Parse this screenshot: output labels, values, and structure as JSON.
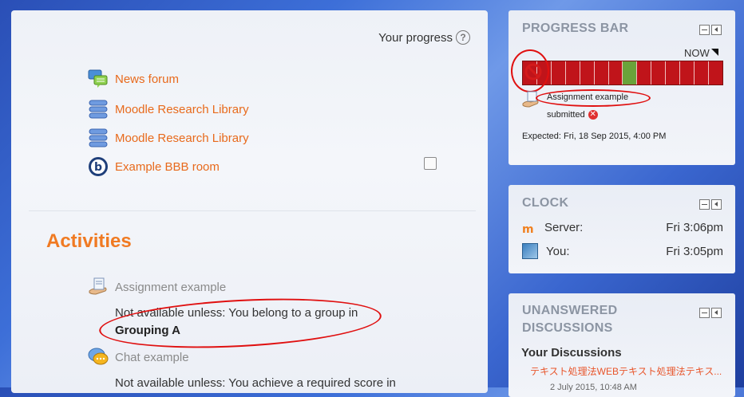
{
  "main": {
    "your_progress": "Your progress",
    "help": "?",
    "resources": [
      {
        "label": "News forum",
        "icon": "forum-icon"
      },
      {
        "label": "Moodle Research Library",
        "icon": "database-icon"
      },
      {
        "label": "Moodle Research Library",
        "icon": "database-icon"
      },
      {
        "label": "Example BBB room",
        "icon": "bigbluebutton-icon"
      }
    ],
    "activities_heading": "Activities",
    "activities": [
      {
        "label": "Assignment example",
        "icon": "assignment-icon",
        "restriction_line1": "Not available unless: You belong to a group in",
        "restriction_line2": "Grouping A"
      },
      {
        "label": "Chat example",
        "icon": "chat-icon",
        "restriction_line1": "Not available unless: You achieve a required score in"
      }
    ]
  },
  "progress_block": {
    "title": "PROGRESS BAR",
    "now_label": "NOW",
    "cells": [
      "red",
      "red",
      "red",
      "red",
      "red",
      "red",
      "red",
      "green",
      "red",
      "red",
      "red",
      "red",
      "red",
      "red"
    ],
    "item_label": "Assignment example",
    "status": "submitted",
    "expected": "Expected: Fri, 18 Sep 2015, 4:00 PM",
    "colors": {
      "red": "#c0141a",
      "green": "#6aa33a"
    }
  },
  "clock_block": {
    "title": "CLOCK",
    "server_label": "Server:",
    "server_time": "Fri 3:06pm",
    "you_label": "You:",
    "you_time": "Fri 3:05pm"
  },
  "unanswered_block": {
    "title_line1": "UNANSWERED",
    "title_line2": "DISCUSSIONS",
    "subheading": "Your Discussions",
    "item_text": "テキスト処理法WEBテキスト処理法テキス...",
    "item_date": "2 July 2015, 10:48 AM"
  }
}
